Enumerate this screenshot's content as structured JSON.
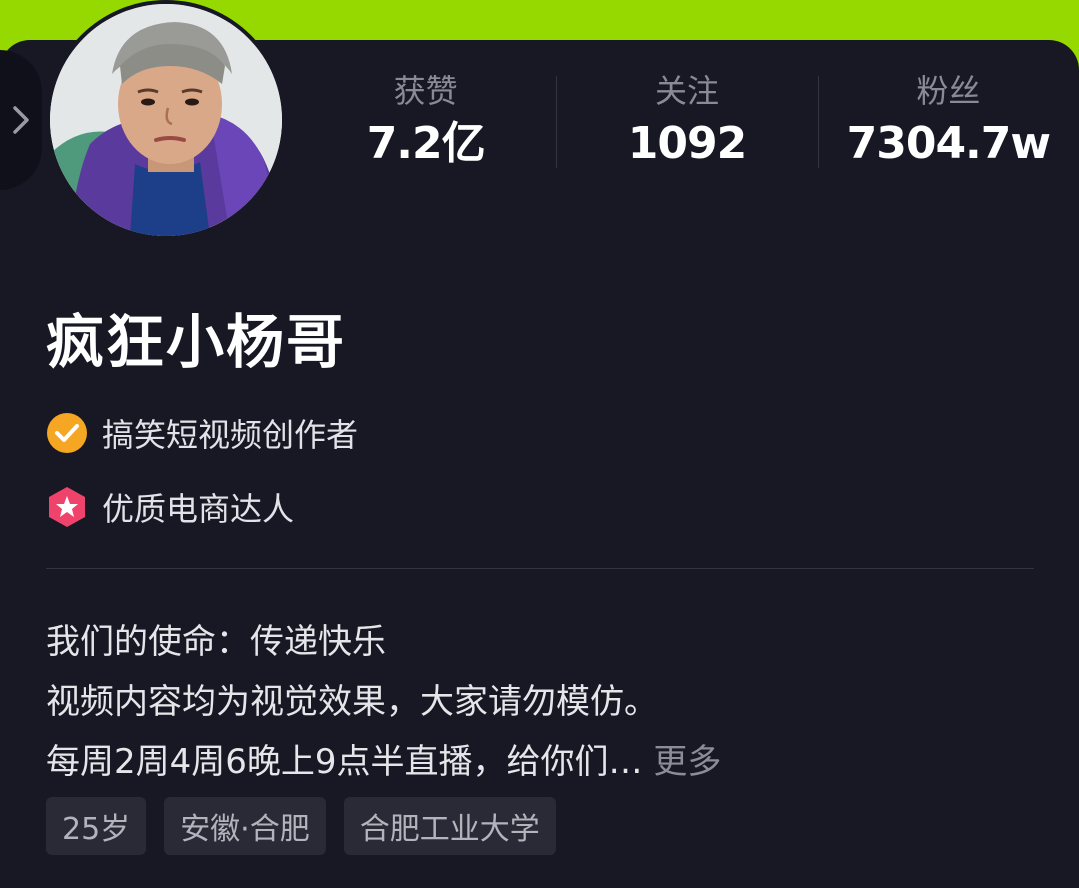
{
  "stats": [
    {
      "label": "获赞",
      "value": "7.2亿"
    },
    {
      "label": "关注",
      "value": "1092"
    },
    {
      "label": "粉丝",
      "value": "7304.7w"
    }
  ],
  "profile": {
    "name": "疯狂小杨哥",
    "badges": [
      {
        "icon": "verified-check-icon",
        "text": "搞笑短视频创作者",
        "color": "#f5a623"
      },
      {
        "icon": "star-hexagon-icon",
        "text": "优质电商达人",
        "color": "#f0436b"
      }
    ]
  },
  "bio": {
    "lines": [
      "我们的使命：传递快乐",
      "视频内容均为视觉效果，大家请勿模仿。",
      "每周2周4周6晚上9点半直播，给你们…"
    ],
    "more_label": "更多"
  },
  "tags": [
    "25岁",
    "安徽·合肥",
    "合肥工业大学"
  ],
  "colors": {
    "top_bar": "#95d900",
    "background": "#181824"
  }
}
